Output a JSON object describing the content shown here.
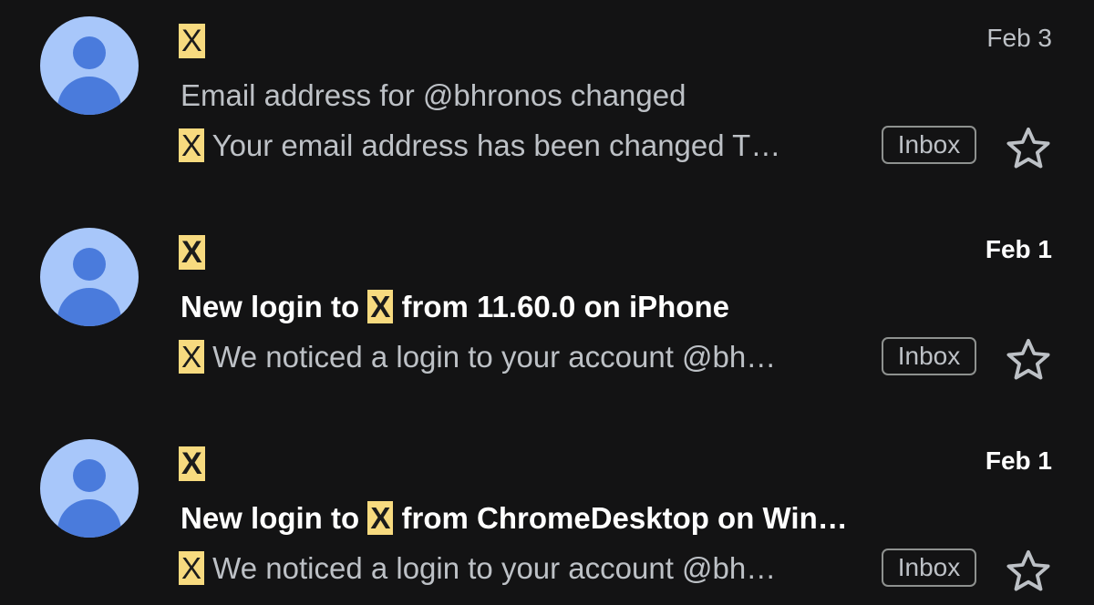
{
  "emails": [
    {
      "sender": "X",
      "date": "Feb 3",
      "subject": "Email address for @bhronos changed",
      "snippet_sender": "X",
      "snippet": " Your email address has been changed T…",
      "label": "Inbox",
      "unread": false
    },
    {
      "sender": "X",
      "date": "Feb 1",
      "subject_prefix": "New login to ",
      "subject_highlight": "X",
      "subject_suffix": " from 11.60.0 on iPhone",
      "snippet_sender": "X",
      "snippet": " We noticed a login to your account @bh…",
      "label": "Inbox",
      "unread": true
    },
    {
      "sender": "X",
      "date": "Feb 1",
      "subject_prefix": "New login to ",
      "subject_highlight": "X",
      "subject_suffix": " from ChromeDesktop on Win…",
      "snippet_sender": "X",
      "snippet": " We noticed a login to your account @bh…",
      "label": "Inbox",
      "unread": true
    }
  ],
  "icons": {
    "avatar": "default-person-avatar",
    "star": "star-outline-icon"
  },
  "colors": {
    "background": "#131314",
    "avatar_bg": "#a8c7fa",
    "avatar_fg": "#4a7bdc",
    "highlight": "#f7da7f"
  }
}
